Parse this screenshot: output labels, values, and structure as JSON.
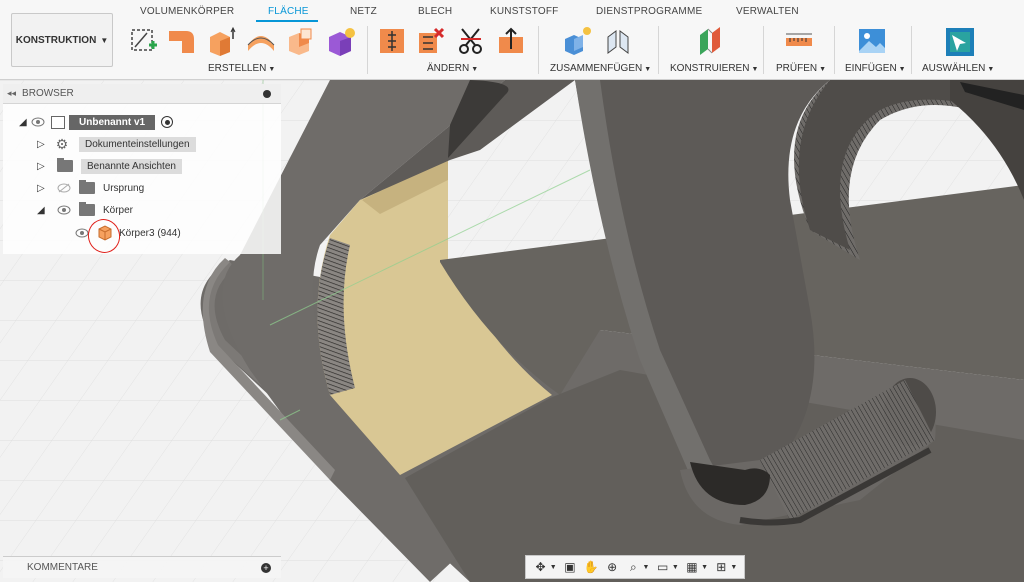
{
  "workspace": {
    "label": "KONSTRUKTION"
  },
  "tabs": [
    {
      "label": "VOLUMENKÖRPER",
      "active": false
    },
    {
      "label": "FLÄCHE",
      "active": true
    },
    {
      "label": "NETZ",
      "active": false
    },
    {
      "label": "BLECH",
      "active": false
    },
    {
      "label": "KUNSTSTOFF",
      "active": false
    },
    {
      "label": "DIENSTPROGRAMME",
      "active": false
    },
    {
      "label": "VERWALTEN",
      "active": false
    }
  ],
  "groups": [
    {
      "label": "ERSTELLEN"
    },
    {
      "label": "ÄNDERN"
    },
    {
      "label": "ZUSAMMENFÜGEN"
    },
    {
      "label": "KONSTRUIEREN"
    },
    {
      "label": "PRÜFEN"
    },
    {
      "label": "EINFÜGEN"
    },
    {
      "label": "AUSWÄHLEN"
    }
  ],
  "tools": [
    "sketch-icon",
    "patch-icon",
    "extrude-icon",
    "loft-icon",
    "sweep-icon",
    "boundary-fill-icon",
    "offset-icon",
    "trim-icon",
    "split-icon",
    "extend-icon",
    "join-icon",
    "joint-icon",
    "plane-icon",
    "measure-icon",
    "insert-image-icon",
    "select-icon"
  ],
  "browser": {
    "title": "BROWSER",
    "root": "Unbenannt v1",
    "items": [
      {
        "label": "Dokumenteinstellungen"
      },
      {
        "label": "Benannte Ansichten"
      },
      {
        "label": "Ursprung"
      },
      {
        "label": "Körper"
      },
      {
        "label": "Körper3 (944)"
      }
    ]
  },
  "comments": {
    "label": "KOMMENTARE"
  },
  "colors": {
    "accent": "#0696d7",
    "model": "#6f6c69",
    "face": "#d9c794",
    "annotation": "#e0201a"
  }
}
